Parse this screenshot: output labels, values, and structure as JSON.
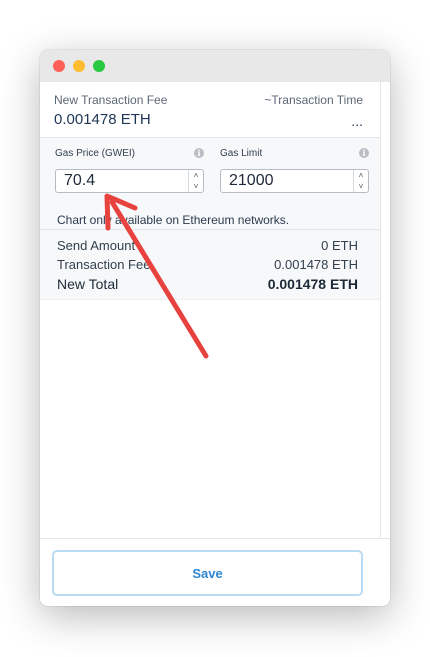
{
  "header": {
    "fee_label": "New Transaction Fee",
    "fee_value": "0.001478 ETH",
    "time_label": "~Transaction Time",
    "time_value": "..."
  },
  "gas_price": {
    "label": "Gas Price (GWEI)",
    "value": "70.4",
    "info_icon": "info-icon"
  },
  "gas_limit": {
    "label": "Gas Limit",
    "value": "21000",
    "info_icon": "info-icon"
  },
  "spinner": {
    "up": "˄",
    "down": "˅"
  },
  "chart_note": "Chart only available on Ethereum networks.",
  "totals": [
    {
      "label": "Send Amount",
      "value": "0 ETH"
    },
    {
      "label": "Transaction Fee",
      "value": "0.001478 ETH"
    },
    {
      "label": "New Total",
      "value": "0.001478 ETH"
    }
  ],
  "footer": {
    "save_label": "Save"
  },
  "colors": {
    "close": "#fe5f57",
    "minimize": "#febc2e",
    "zoom": "#28c840",
    "accent": "#2f86d1",
    "annotation_arrow": "#e8423f"
  }
}
